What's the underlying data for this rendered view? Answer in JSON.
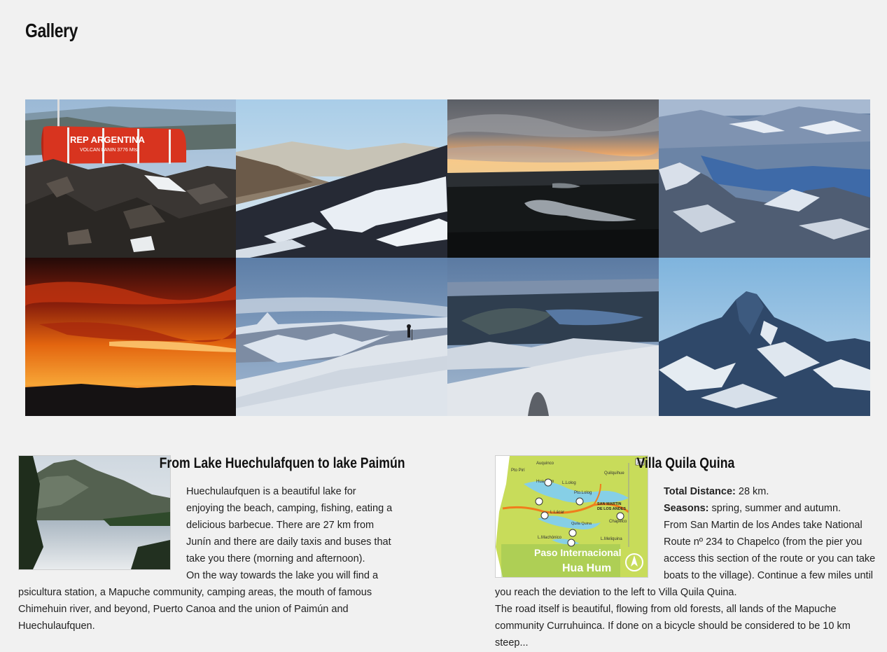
{
  "page": {
    "title": "Gallery"
  },
  "gallery": {
    "images": [
      {
        "name": "refugio-rep-argentina",
        "sign_text": "REP ARGENTINA",
        "sign_sub": "VOLCAN LANIN 3776 Mts"
      },
      {
        "name": "mountain-slopes"
      },
      {
        "name": "sunset-lake"
      },
      {
        "name": "andes-aerial-lake"
      },
      {
        "name": "red-sunset"
      },
      {
        "name": "snowy-summit-hiker"
      },
      {
        "name": "lakes-from-summit"
      },
      {
        "name": "rocky-peak"
      }
    ]
  },
  "articles": [
    {
      "title": "From Lake Huechulafquen to lake Paimún",
      "paragraphs": [
        "Huechulaufquen is a beautiful lake for enjoying the beach, camping, fishing, eating a delicious barbecue. There are 27 km from Junín and there are daily taxis and buses that take you there (morning and afternoon).",
        "On the way towards the lake you will find a psicultura station, a Mapuche community, camping areas, the mouth of famous Chimehuin river, and beyond, Puerto Canoa and the union of Paimún and Huechulaufquen."
      ]
    },
    {
      "title": "Villa Quila Quina",
      "distance_label": "Total Distance:",
      "distance_value": " 28 km.",
      "seasons_label": "Seasons:",
      "seasons_value": " spring, summer and autumn.",
      "paragraphs": [
        "From San Martin de los Andes take National Route nº 234 to Chapelco (from the pier you access this section of the route or you can take boats to the village). Continue a few miles until you reach the deviation to the left to Villa Quila Quina.",
        "The road itself is beautiful, flowing from old forests, all lands of the Mapuche community Curruhuinca. If done on a bicycle should be considered to be 10 km steep..."
      ],
      "map": {
        "banner_line1": "Paso Internacional",
        "banner_line2": "Hua Hum",
        "labels": [
          "Auquinco",
          "Quilquihue",
          "L.Lolog",
          "Pto.Lolog",
          "SAN MARTIN",
          "DE LOS ANDES",
          "Chapelco",
          "Quila Quina",
          "L.Lácar",
          "L.Meliquina",
          "L.Machónico",
          "Hua Hum",
          "Pto Pirí"
        ],
        "route_number": "234"
      }
    }
  ]
}
